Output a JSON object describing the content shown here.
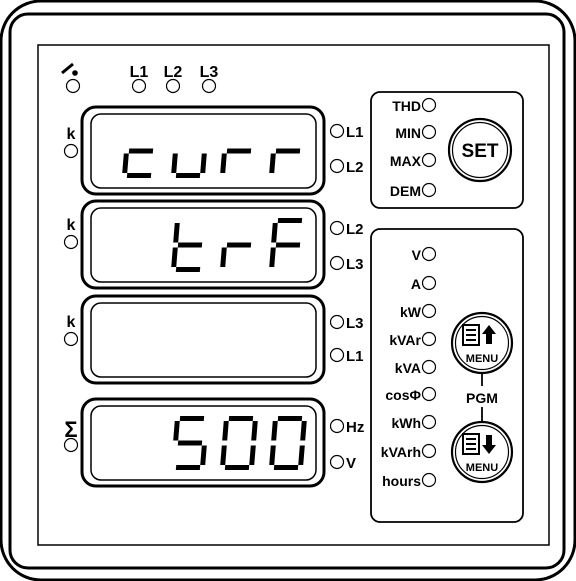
{
  "top_leds": [
    "L1",
    "L2",
    "L3"
  ],
  "k_label": "k",
  "sigma_label": "Σ",
  "displays": [
    {
      "text": "curr",
      "phase_top": "L1",
      "phase_bottom": "L2"
    },
    {
      "text": "trF",
      "phase_top": "L2",
      "phase_bottom": "L3"
    },
    {
      "text": "",
      "phase_top": "L3",
      "phase_bottom": "L1"
    },
    {
      "text": "500",
      "phase_top": "Hz",
      "phase_bottom": "V"
    }
  ],
  "mode_indicators": [
    "THD",
    "MIN",
    "MAX",
    "DEM"
  ],
  "set_button": "SET",
  "unit_indicators": [
    "V",
    "A",
    "kW",
    "kVAr",
    "kVA",
    "cosΦ",
    "kWh",
    "kVArh",
    "hours"
  ],
  "menu_up_label": "MENU",
  "menu_down_label": "MENU",
  "pgm_label": "PGM"
}
